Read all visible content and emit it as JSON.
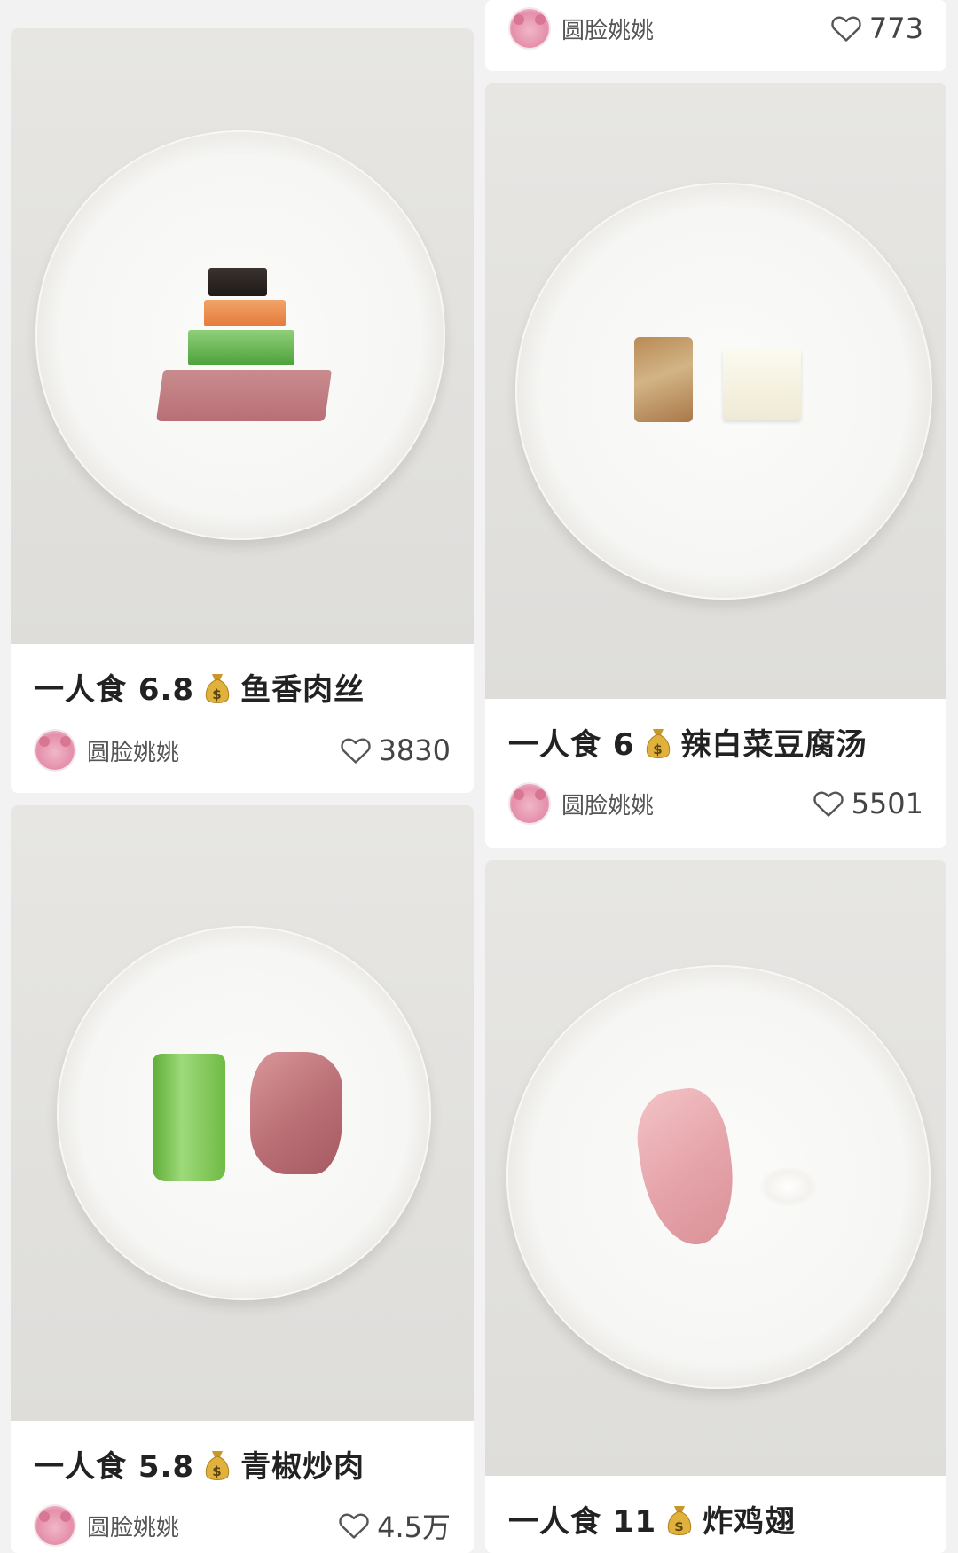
{
  "cards": [
    {
      "title_prefix": "一人食 6.8",
      "dish": "鱼香肉丝",
      "author": "圆脸姚姚",
      "likes": "3830"
    },
    {
      "title_prefix": "一人食 6",
      "dish": "辣白菜豆腐汤",
      "author": "圆脸姚姚",
      "likes": "5501"
    },
    {
      "title_prefix": "一人食 5.8",
      "dish": "青椒炒肉",
      "author": "圆脸姚姚",
      "likes": "4.5万"
    },
    {
      "title_prefix": "一人食 11",
      "dish": "炸鸡翅"
    },
    {
      "author": "圆脸姚姚",
      "likes": "773"
    }
  ],
  "icons": {
    "money": "money-bag-icon",
    "heart": "heart-outline-icon"
  },
  "colors": {
    "background": "#f3f2f2",
    "card": "#ffffff",
    "text": "#222222",
    "meta_text": "#555555"
  }
}
